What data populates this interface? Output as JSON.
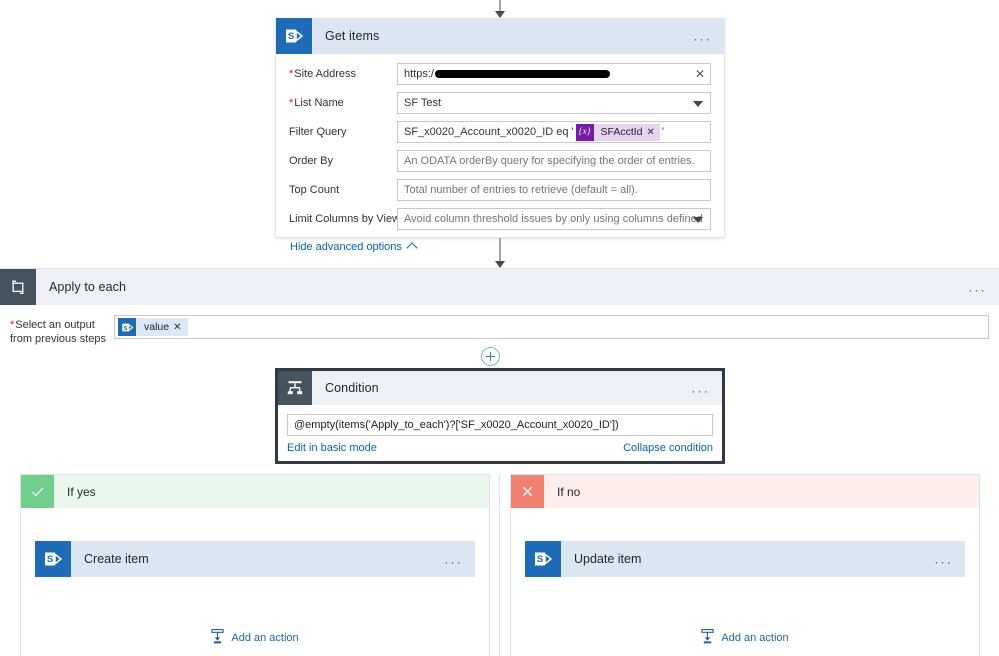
{
  "flow": {
    "get_items": {
      "title": "Get items",
      "icon": "sharepoint-icon",
      "overflow_label": "...",
      "fields": [
        {
          "label": "Site Address",
          "required": true,
          "value": "https:/",
          "redacted": true,
          "action_icon": "clear-icon",
          "action_glyph": "✕"
        },
        {
          "label": "List Name",
          "required": true,
          "value": "SF Test",
          "control": "dropdown"
        },
        {
          "label": "Filter Query",
          "required": false,
          "value": "SF_x0020_Account_x0020_ID eq '",
          "value_suffix": "'",
          "token": {
            "badge": "{x}",
            "label": "SFAcctId",
            "remove_glyph": "✕"
          }
        },
        {
          "label": "Order By",
          "required": false,
          "placeholder": "An ODATA orderBy query for specifying the order of entries."
        },
        {
          "label": "Top Count",
          "required": false,
          "placeholder": "Total number of entries to retrieve (default = all)."
        },
        {
          "label": "Limit Columns by View",
          "required": false,
          "placeholder": "Avoid column threshold issues by only using columns defined in a view",
          "control": "dropdown"
        }
      ],
      "advanced_link": "Hide advanced options"
    },
    "apply_to_each": {
      "title": "Apply to each",
      "icon": "loop-icon",
      "overflow_label": "...",
      "input_label_line1": "Select an output",
      "input_label_line2": "from previous steps",
      "required": true,
      "chip": {
        "icon": "sharepoint-icon",
        "label": "value",
        "remove_glyph": "✕"
      },
      "add_step_icon": "plus-circle-icon"
    },
    "condition": {
      "title": "Condition",
      "icon": "condition-icon",
      "overflow_label": "...",
      "expression": "@empty(items('Apply_to_each')?['SF_x0020_Account_x0020_ID'])",
      "edit_mode_link": "Edit in basic mode",
      "collapse_link": "Collapse condition"
    },
    "branches": [
      {
        "id": "yes",
        "title": "If yes",
        "badge_icon": "check-icon",
        "badge_glyph": "✓",
        "action": {
          "title": "Create item",
          "icon": "sharepoint-icon",
          "overflow_label": "..."
        },
        "add_action_label": "Add an action",
        "add_action_icon": "add-action-icon"
      },
      {
        "id": "no",
        "title": "If no",
        "badge_icon": "close-icon",
        "badge_glyph": "✕",
        "action": {
          "title": "Update item",
          "icon": "sharepoint-icon",
          "overflow_label": "..."
        },
        "add_action_label": "Add an action",
        "add_action_icon": "add-action-icon"
      }
    ]
  },
  "colors": {
    "sharepoint_blue": "#1e6bb8",
    "card_header_blue": "#dce6f2",
    "card_header_grey": "#eef1f4",
    "link_blue": "#0067b8",
    "yes_green": "#6fcf8b",
    "no_red": "#f08070",
    "token_purple": "#7719aa",
    "required_red": "#e81123"
  }
}
